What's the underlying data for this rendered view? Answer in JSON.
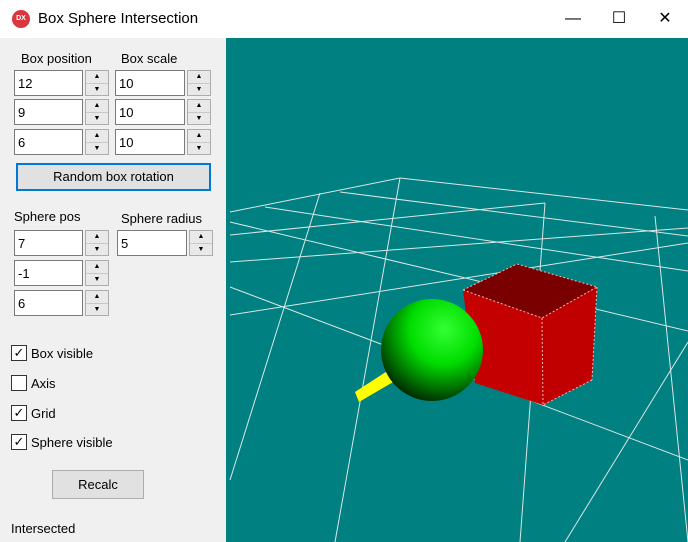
{
  "window": {
    "title": "Box Sphere Intersection",
    "icon_text": "DX",
    "minimize": "—",
    "maximize": "☐",
    "close": "✕"
  },
  "box": {
    "position_label": "Box position",
    "scale_label": "Box scale",
    "position": [
      "12",
      "9",
      "6"
    ],
    "scale": [
      "10",
      "10",
      "10"
    ],
    "random_rotation_label": "Random box rotation"
  },
  "sphere": {
    "pos_label": "Sphere pos",
    "radius_label": "Sphere radius",
    "pos": [
      "7",
      "-1",
      "6"
    ],
    "radius": "5"
  },
  "spinner": {
    "up": "▲",
    "down": "▼"
  },
  "checkboxes": [
    {
      "label": "Box visible",
      "checked": true,
      "mark": "✓"
    },
    {
      "label": "Axis",
      "checked": false,
      "mark": ""
    },
    {
      "label": "Grid",
      "checked": true,
      "mark": "✓"
    },
    {
      "label": "Sphere visible",
      "checked": true,
      "mark": "✓"
    }
  ],
  "recalc_label": "Recalc",
  "status": "Intersected",
  "colors": {
    "viewport_bg": "#008080",
    "box": "#c00000",
    "sphere": "#00cc00",
    "axis": "#ffff00",
    "grid": "#d9e6e6"
  }
}
